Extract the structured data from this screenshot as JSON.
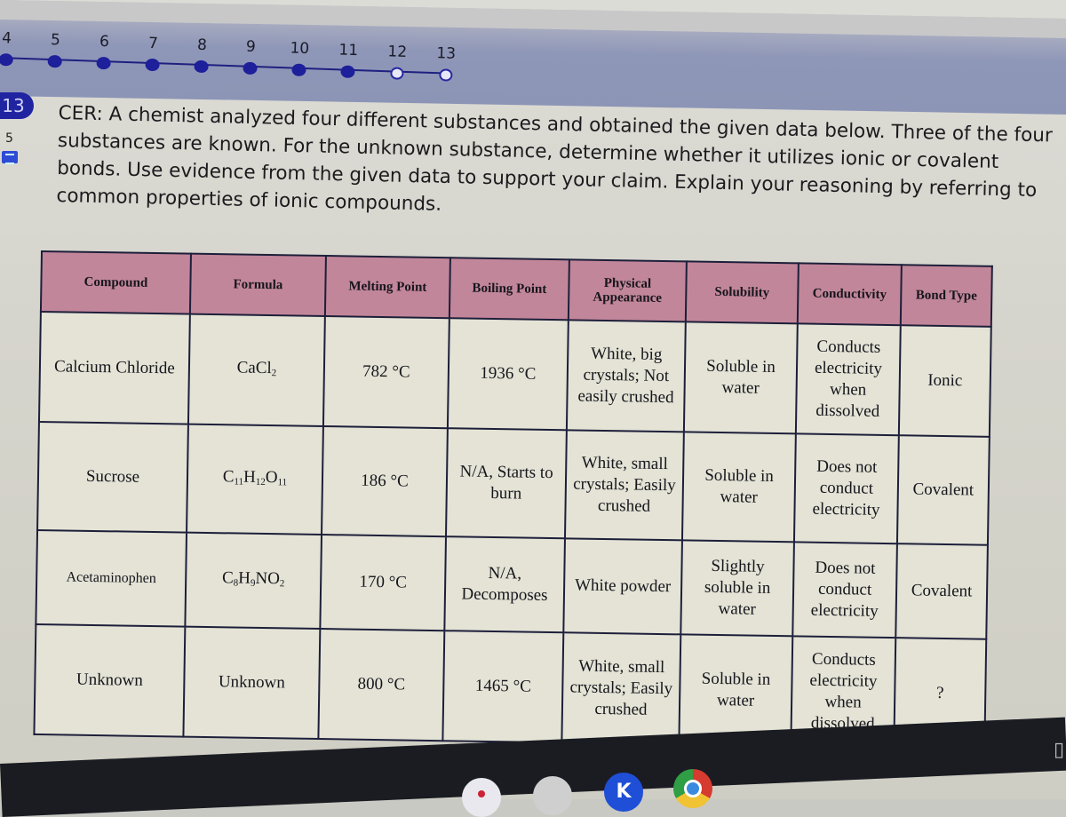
{
  "progress": {
    "steps": [
      {
        "label": "4",
        "state": "completed"
      },
      {
        "label": "5",
        "state": "completed"
      },
      {
        "label": "6",
        "state": "completed"
      },
      {
        "label": "7",
        "state": "completed"
      },
      {
        "label": "8",
        "state": "completed"
      },
      {
        "label": "9",
        "state": "completed"
      },
      {
        "label": "10",
        "state": "completed"
      },
      {
        "label": "11",
        "state": "completed"
      },
      {
        "label": "12",
        "state": "incomplete"
      },
      {
        "label": "13",
        "state": "incomplete"
      }
    ],
    "colors": {
      "active": "#1e1f9a",
      "band": "#8f97b8"
    }
  },
  "question": {
    "number": "13",
    "points": "5",
    "comment_icon": "comment-icon",
    "prompt": "CER: A chemist analyzed four different substances and obtained the given data below. Three of the four substances are known. For the unknown substance, determine whether it utilizes ionic or covalent bonds. Use evidence from the given data to support your claim. Explain your reasoning by referring to common properties of ionic compounds."
  },
  "table": {
    "header_color": "#c2869a",
    "columns": [
      "Compound",
      "Formula",
      "Melting Point",
      "Boiling Point",
      "Physical Appearance",
      "Solubility",
      "Conductivity",
      "Bond Type"
    ],
    "rows": [
      {
        "compound": "Calcium Chloride",
        "formula": {
          "parts": [
            [
              "Ca",
              ""
            ],
            [
              "Cl",
              "2"
            ]
          ]
        },
        "melting_point": "782 °C",
        "boiling_point": "1936 °C",
        "appearance": "White, big crystals; Not easily crushed",
        "solubility": "Soluble in water",
        "conductivity": "Conducts electricity when dissolved",
        "bond_type": "Ionic"
      },
      {
        "compound": "Sucrose",
        "formula": {
          "parts": [
            [
              "C",
              "11"
            ],
            [
              "H",
              "12"
            ],
            [
              "O",
              "11"
            ]
          ]
        },
        "melting_point": "186 °C",
        "boiling_point": "N/A, Starts to burn",
        "appearance": "White, small crystals; Easily crushed",
        "solubility": "Soluble in water",
        "conductivity": "Does not conduct electricity",
        "bond_type": "Covalent"
      },
      {
        "compound": "Acetaminophen",
        "formula": {
          "parts": [
            [
              "C",
              "8"
            ],
            [
              "H",
              "9"
            ],
            [
              "NO",
              "2"
            ]
          ]
        },
        "melting_point": "170 °C",
        "boiling_point": "N/A, Decomposes",
        "appearance": "White powder",
        "solubility": "Slightly soluble in water",
        "conductivity": "Does not conduct electricity",
        "bond_type": "Covalent"
      },
      {
        "compound": "Unknown",
        "formula": {
          "text": "Unknown"
        },
        "melting_point": "800 °C",
        "boiling_point": "1465 °C",
        "appearance": "White, small crystals; Easily crushed",
        "solubility": "Soluble in water",
        "conductivity": "Conducts electricity when dissolved",
        "bond_type": "?"
      }
    ]
  },
  "taskbar": {
    "apps": [
      {
        "name": "camera-app-icon"
      },
      {
        "name": "files-app-icon"
      },
      {
        "name": "kahoot-app-icon",
        "glyph": "K"
      },
      {
        "name": "chrome-app-icon"
      }
    ]
  }
}
